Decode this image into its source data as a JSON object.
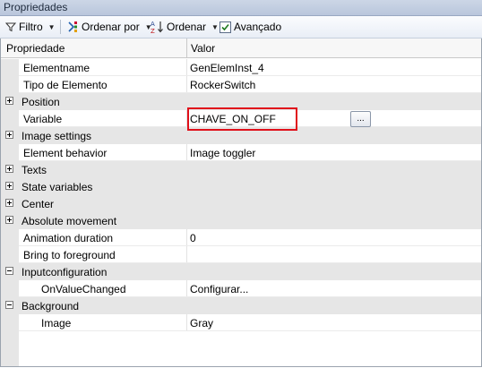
{
  "window": {
    "title": "Propriedades"
  },
  "toolbar": {
    "filter_label": "Filtro",
    "sort_by_label": "Ordenar por",
    "sort_label": "Ordenar",
    "advanced_label": "Avançado",
    "advanced_checked": true
  },
  "grid": {
    "col_property": "Propriedade",
    "col_value": "Valor",
    "rows": [
      {
        "name": "Elementname",
        "value": "GenElemInst_4"
      },
      {
        "name": "Tipo de Elemento",
        "value": "RockerSwitch"
      },
      {
        "name": "Position",
        "value": "",
        "expander": "plus"
      },
      {
        "name": "Variable",
        "value": "CHAVE_ON_OFF",
        "button": "..."
      },
      {
        "name": "Image settings",
        "value": "",
        "expander": "plus"
      },
      {
        "name": "Element behavior",
        "value": "Image toggler"
      },
      {
        "name": "Texts",
        "value": "",
        "expander": "plus"
      },
      {
        "name": "State variables",
        "value": "",
        "expander": "plus"
      },
      {
        "name": "Center",
        "value": "",
        "expander": "plus"
      },
      {
        "name": "Absolute movement",
        "value": "",
        "expander": "plus"
      },
      {
        "name": "Animation duration",
        "value": "0"
      },
      {
        "name": "Bring to foreground",
        "value": ""
      },
      {
        "name": "Inputconfiguration",
        "value": "",
        "expander": "minus"
      },
      {
        "name": "OnValueChanged",
        "value": "Configurar..."
      },
      {
        "name": "Background",
        "value": "",
        "expander": "minus"
      },
      {
        "name": "Image",
        "value": "Gray"
      }
    ]
  },
  "colors": {
    "highlight": "#e0101a",
    "category_bg": "#e6e6e6"
  }
}
